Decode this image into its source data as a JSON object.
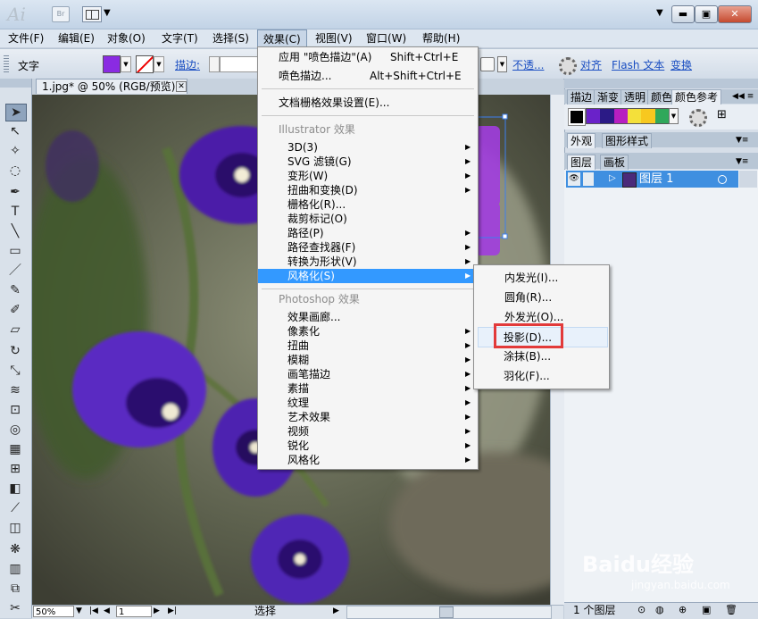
{
  "app": {
    "logo": "Ai",
    "bridge_label": "Br"
  },
  "menubar": [
    "文件(F)",
    "编辑(E)",
    "对象(O)",
    "文字(T)",
    "选择(S)",
    "效果(C)",
    "视图(V)",
    "窗口(W)",
    "帮助(H)"
  ],
  "control": {
    "label": "文字",
    "fill_color": "#8a2be2",
    "stroke_label": "描边:",
    "opacity_label": "不透...",
    "align_label": "对齐",
    "flash_label": "Flash 文本",
    "transform_label": "变换"
  },
  "document": {
    "tab_title": "1.jpg* @ 50% (RGB/预览)",
    "zoom": "50%",
    "page": "1",
    "status": "选择"
  },
  "effect_menu": {
    "apply_last": "应用 \"喷色描边\"(A)",
    "apply_last_shortcut": "Shift+Ctrl+E",
    "last_effect": "喷色描边...",
    "last_effect_shortcut": "Alt+Shift+Ctrl+E",
    "doc_raster": "文档栅格效果设置(E)...",
    "illustrator_header": "Illustrator 效果",
    "illustrator_items": [
      "3D(3)",
      "SVG 滤镜(G)",
      "变形(W)",
      "扭曲和变换(D)",
      "栅格化(R)...",
      "裁剪标记(O)",
      "路径(P)",
      "路径查找器(F)",
      "转换为形状(V)",
      "风格化(S)"
    ],
    "photoshop_header": "Photoshop 效果",
    "photoshop_items": [
      "效果画廊...",
      "像素化",
      "扭曲",
      "模糊",
      "画笔描边",
      "素描",
      "纹理",
      "艺术效果",
      "视频",
      "锐化",
      "风格化"
    ]
  },
  "stylize_submenu": [
    "内发光(I)...",
    "圆角(R)...",
    "外发光(O)...",
    "投影(D)...",
    "涂抹(B)...",
    "羽化(F)..."
  ],
  "panels": {
    "row1_tabs": [
      "描边",
      "渐变",
      "透明",
      "颜色",
      "颜色参考"
    ],
    "row2_tabs": [
      "外观",
      "图形样式"
    ],
    "row3_tabs": [
      "图层",
      "画板"
    ],
    "reference_colors": [
      "#6a22c9",
      "#2b1a86",
      "#b71ec1",
      "#f4e03a",
      "#f7c81f",
      "#2fa85a"
    ],
    "layer_name": "图层 1",
    "layer_count": "1 个图层"
  },
  "watermark": {
    "brand": "Baidu经验",
    "url": "jingyan.baidu.com"
  }
}
